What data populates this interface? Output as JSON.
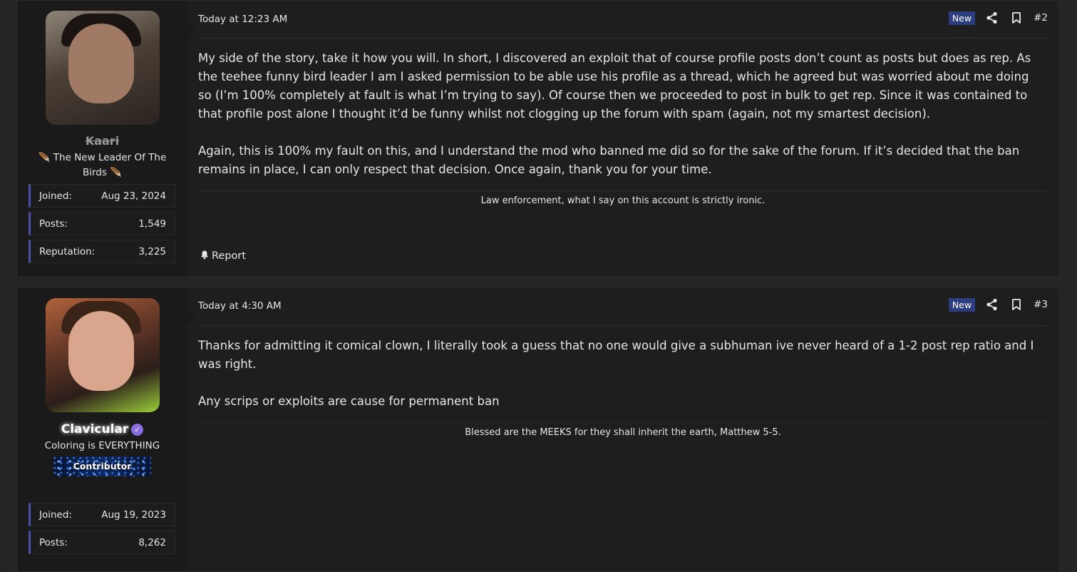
{
  "posts": [
    {
      "username": "Kaari",
      "user_title": "🪶 The New Leader Of The Birds 🪶",
      "stats": [
        {
          "label": "Joined:",
          "value": "Aug 23, 2024"
        },
        {
          "label": "Posts:",
          "value": "1,549"
        },
        {
          "label": "Reputation:",
          "value": "3,225"
        }
      ],
      "date": "Today at 12:23 AM",
      "badge": "New",
      "post_number": "#2",
      "paragraphs": [
        "My side of the story, take it how you will. In short, I discovered an exploit that of course profile posts don’t count as posts but does as rep. As the teehee funny bird leader I am I asked permission to be able use his profile as a thread, which he agreed but was worried about me doing so (I’m 100% completely at fault is what I’m trying to say). Of course then we proceeded to post in bulk to get rep. Since it was contained to that profile post alone I thought it’d be funny whilst not clogging up the forum with spam (again, not my smartest decision).",
        "Again, this is 100% my fault on this, and I understand the mod who banned me did so for the sake of the forum. If it’s decided that the ban remains in place, I can only respect that decision. Once again, thank you for your time."
      ],
      "signature": "Law enforcement, what I say on this account is strictly ironic.",
      "report_label": "Report"
    },
    {
      "username": "Clavicular",
      "user_title": "Coloring is EVERYTHING",
      "banner": "Contributor",
      "stats": [
        {
          "label": "Joined:",
          "value": "Aug 19, 2023"
        },
        {
          "label": "Posts:",
          "value": "8,262"
        }
      ],
      "date": "Today at 4:30 AM",
      "badge": "New",
      "post_number": "#3",
      "paragraphs": [
        "Thanks for admitting it comical clown, I literally took a guess that no one would give a subhuman ive never heard of a 1-2 post rep ratio and I was right.",
        "Any scrips or exploits are cause for permanent ban"
      ],
      "signature": "Blessed are the MEEKS for they shall inherit the earth, Matthew 5-5."
    }
  ],
  "colors": {
    "page_bg": "#252525",
    "post_bg": "#1e1e1e",
    "user_col_bg": "#1a1a1a",
    "badge_new": "#2c3d80",
    "stat_accent": "#4b4ea8",
    "verified": "#8a6be0"
  },
  "icons": [
    "share-icon",
    "bookmark-icon",
    "bell-icon",
    "verified-icon"
  ]
}
